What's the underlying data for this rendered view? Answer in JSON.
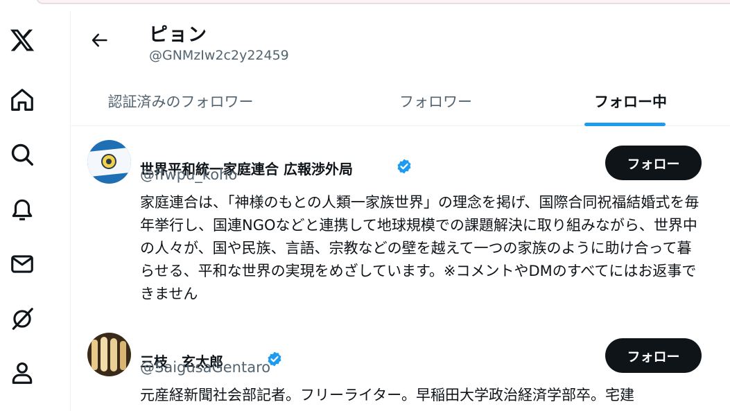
{
  "profile": {
    "name": "ピョン",
    "handle": "@GNMzIw2c2y22459"
  },
  "tabs": [
    {
      "label": "認証済みのフォロワー",
      "active": false
    },
    {
      "label": "フォロワー",
      "active": false
    },
    {
      "label": "フォロー中",
      "active": true
    }
  ],
  "nav": [
    {
      "icon": "x-logo-icon"
    },
    {
      "icon": "home-icon"
    },
    {
      "icon": "search-icon"
    },
    {
      "icon": "notifications-bell-icon"
    },
    {
      "icon": "messages-envelope-icon"
    },
    {
      "icon": "grok-icon"
    },
    {
      "icon": "profile-person-icon"
    }
  ],
  "users": [
    {
      "name": "世界平和統一家庭連合 広報渉外局",
      "handle": "@ffwpu_koho",
      "verified": true,
      "follow_label": "フォロー",
      "bio": "家庭連合は、「神様のもとの人類一家族世界」の理念を掲げ、国際合同祝福結婚式を毎年挙行し、国連NGOなどと連携して地球規模での課題解決に取り組みながら、世界中の人々が、国や民族、言語、宗教などの壁を越えて一つの家族のように助け合って暮らせる、平和な世界の実現をめざしています。※コメントやDMのすべてにはお返事できません"
    },
    {
      "name": "三枝　玄太郎",
      "handle": "@SaigusaGentaro",
      "verified": true,
      "follow_label": "フォロー",
      "bio": "元産経新聞社会部記者。フリーライター。早稲田大学政治経済学部卒。宅建"
    }
  ],
  "colors": {
    "accent": "#1d9bf0",
    "text_primary": "#0f1419",
    "text_secondary": "#536471",
    "button_bg": "#0f1419"
  }
}
